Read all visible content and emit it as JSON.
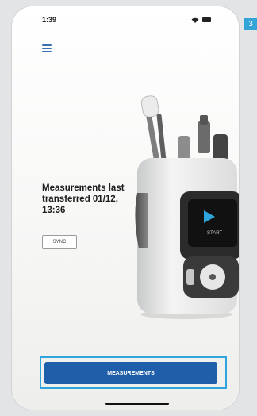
{
  "step_badge": "3",
  "status_bar": {
    "time": "1:39",
    "signal_icon": "signal-icon",
    "battery_icon": "battery-icon"
  },
  "menu": {
    "icon": "hamburger-menu-icon"
  },
  "info": {
    "title": "Measurements last transferred 01/12, 13:36"
  },
  "sync_button": {
    "label": "SYNC"
  },
  "measurements_button": {
    "label": "MEASUREMENTS"
  },
  "device_screen": {
    "label": "START",
    "icon": "play-icon"
  },
  "colors": {
    "primary_button": "#1f5ea8",
    "highlight": "#2ea6dd",
    "menu_icon": "#3a6fb0"
  }
}
